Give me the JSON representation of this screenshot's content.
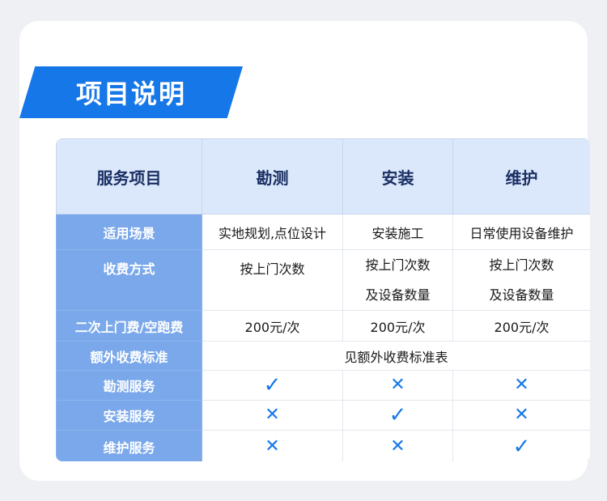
{
  "section": {
    "title": "项目说明"
  },
  "table": {
    "header": {
      "service": "服务项目",
      "survey": "勘测",
      "install": "安装",
      "maintenance": "维护"
    },
    "rows": [
      {
        "label": "适用场景",
        "survey": "实地规划,点位设计",
        "install": "安装施工",
        "maintenance": "日常使用设备维护"
      },
      {
        "label": "收费方式",
        "survey": "按上门次数",
        "install_line1": "按上门次数",
        "install_line2": "及设备数量",
        "maintenance_line1": "按上门次数",
        "maintenance_line2": "及设备数量"
      },
      {
        "label": "二次上门费/空跑费",
        "survey": "200元/次",
        "install": "200元/次",
        "maintenance": "200元/次"
      },
      {
        "label": "额外收费标准",
        "merged": "见额外收费标准表"
      },
      {
        "label": "勘测服务",
        "survey": "✓",
        "install": "✕",
        "maintenance": "✕"
      },
      {
        "label": "安装服务",
        "survey": "✕",
        "install": "✓",
        "maintenance": "✕"
      },
      {
        "label": "维护服务",
        "survey": "✕",
        "install": "✕",
        "maintenance": "✓"
      }
    ]
  },
  "colors": {
    "accent": "#1677e8",
    "header_bg": "#dbe8fb",
    "row_header_bg": "#7aa8ea"
  }
}
